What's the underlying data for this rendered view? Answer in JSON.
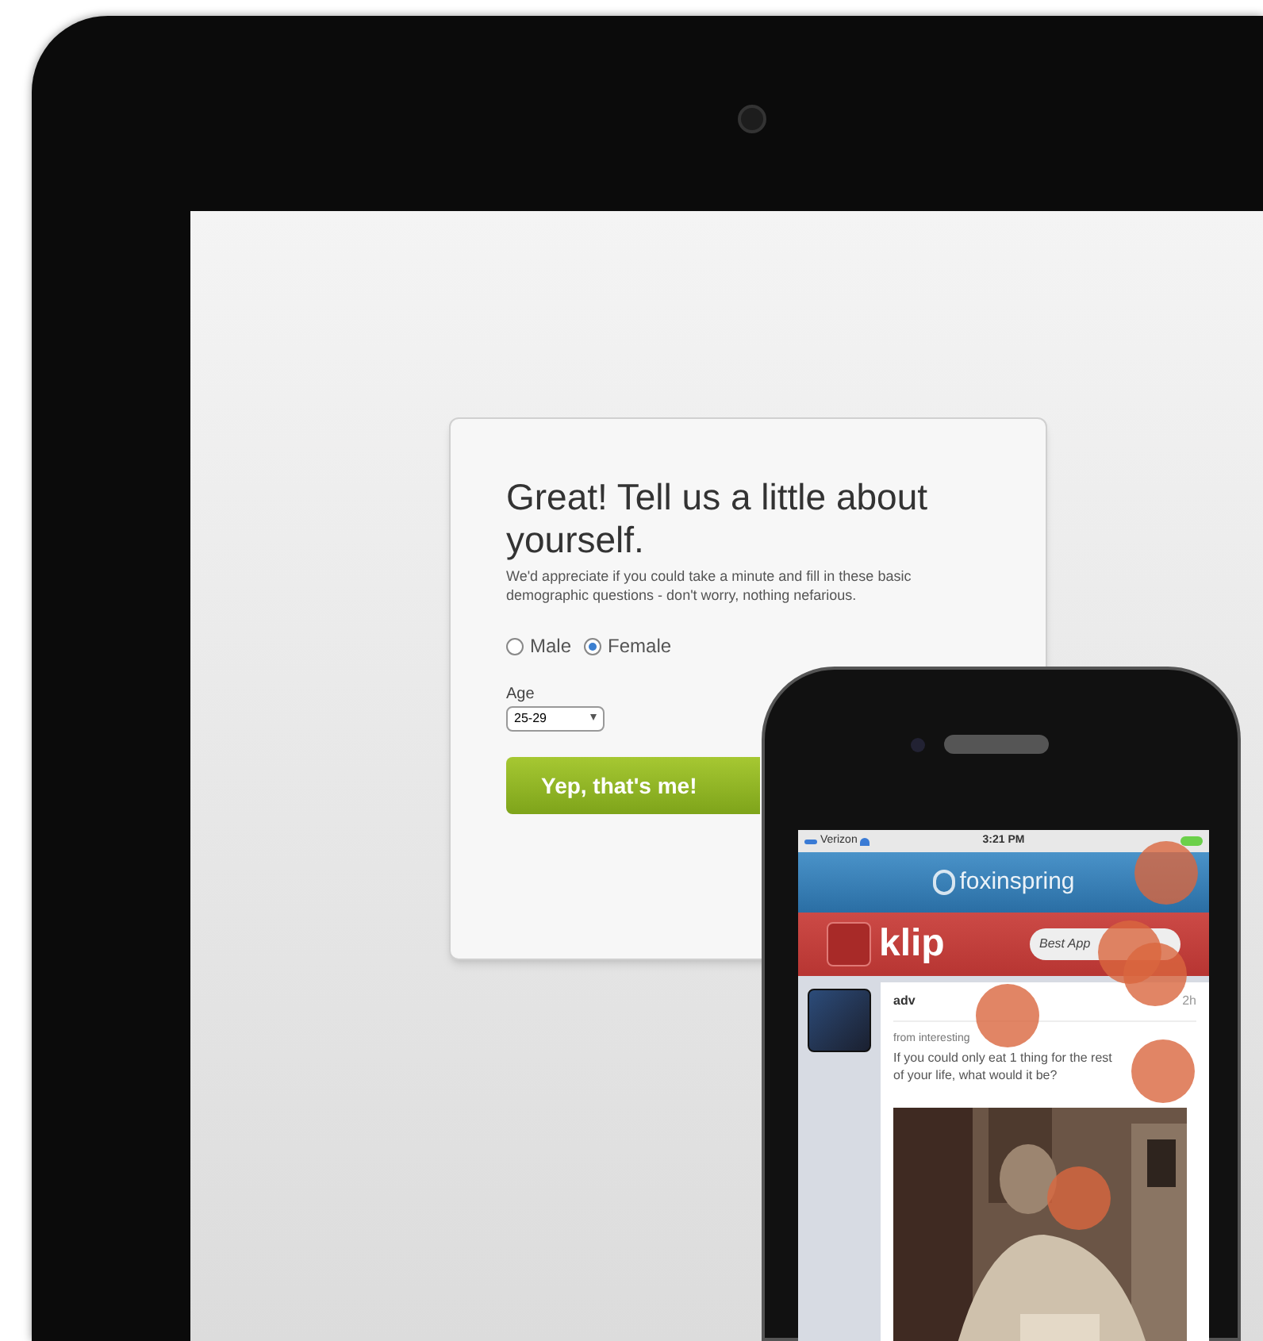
{
  "form": {
    "title": "Great! Tell us a little about yourself.",
    "description": "We'd appreciate if you could take a minute and fill in these basic demographic questions - don't worry, nothing nefarious.",
    "gender_options": [
      {
        "label": "Male",
        "selected": false
      },
      {
        "label": "Female",
        "selected": true
      }
    ],
    "age": {
      "label": "Age",
      "value": "25-29"
    },
    "submit": "Yep, that's me!"
  },
  "phone": {
    "status_bar": {
      "carrier": "Verizon",
      "time": "3:21 PM"
    },
    "app_bar": {
      "logo": "foxinspring"
    },
    "header": {
      "title": "klip",
      "button": "Best App"
    },
    "post": {
      "author": "adv",
      "time": "2h",
      "from": "from interesting",
      "text": "If you could only eat 1 thing for the rest of your life, what would it be?"
    }
  }
}
